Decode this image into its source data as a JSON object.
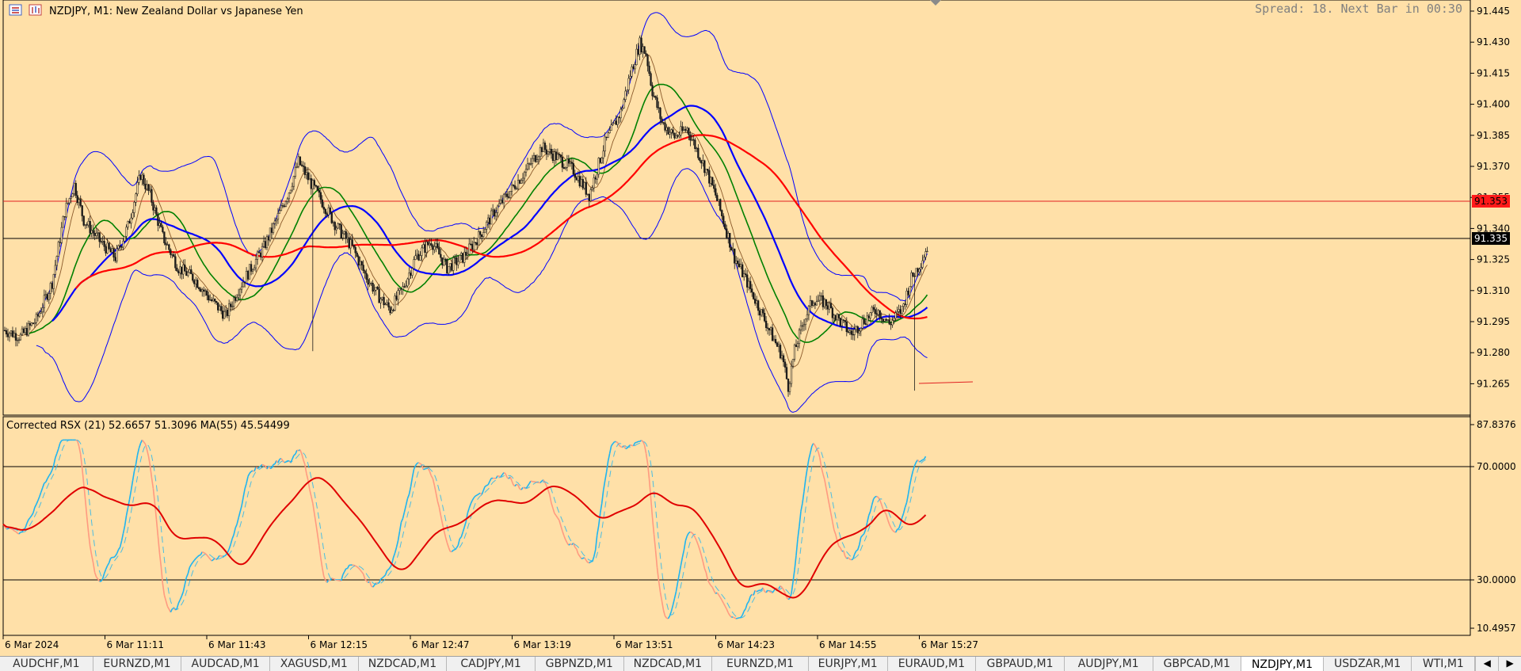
{
  "header": {
    "symbol_title": "NZDJPY, M1:  New Zealand Dollar vs Japanese Yen",
    "spread_text": "Spread: 18. Next Bar in 00:30",
    "menu_icon": "chart-menu-icon",
    "chart_icon": "chart-type-icon"
  },
  "colors": {
    "background": "#ffe0a8",
    "candles": "#1a1a1a",
    "bollinger": "#0000ff",
    "ma_red": "#ff0000",
    "ma_blue": "#0000ff",
    "ma_green": "#008000",
    "ma_thin": "#8b5a2b",
    "rsx_up": "#1eb4f0",
    "rsx_down": "#ff9a80",
    "rsx_ma": "#e00000"
  },
  "price_panel": {
    "ticks": [
      "91.445",
      "91.430",
      "91.415",
      "91.400",
      "91.385",
      "91.370",
      "91.355",
      "91.340",
      "91.325",
      "91.310",
      "91.295",
      "91.280",
      "91.265"
    ],
    "level_line_label": "91.353",
    "current_price_label": "91.335"
  },
  "indicator_panel": {
    "title": "Corrected RSX (21) 52.6657 51.3096 MA(55) 45.54499",
    "ticks": [
      "87.8376",
      "70.0000",
      "30.0000",
      "10.4957"
    ]
  },
  "time_axis": [
    "6 Mar 2024",
    "6 Mar 11:11",
    "6 Mar 11:43",
    "6 Mar 12:15",
    "6 Mar 12:47",
    "6 Mar 13:19",
    "6 Mar 13:51",
    "6 Mar 14:23",
    "6 Mar 14:55",
    "6 Mar 15:27"
  ],
  "tabs": [
    {
      "label": "AUDCHF,M1",
      "active": false
    },
    {
      "label": "EURNZD,M1",
      "active": false
    },
    {
      "label": "AUDCAD,M1",
      "active": false
    },
    {
      "label": "XAGUSD,M1",
      "active": false
    },
    {
      "label": "NZDCAD,M1",
      "active": false
    },
    {
      "label": "CADJPY,M1",
      "active": false
    },
    {
      "label": "GBPNZD,M1",
      "active": false
    },
    {
      "label": "NZDCAD,M1",
      "active": false
    },
    {
      "label": "EURNZD,M1",
      "active": false
    },
    {
      "label": "EURJPY,M1",
      "active": false
    },
    {
      "label": "EURAUD,M1",
      "active": false
    },
    {
      "label": "GBPAUD,M1",
      "active": false
    },
    {
      "label": "AUDJPY,M1",
      "active": false
    },
    {
      "label": "GBPCAD,M1",
      "active": false
    },
    {
      "label": "NZDJPY,M1",
      "active": true
    },
    {
      "label": "USDZAR,M1",
      "active": false
    },
    {
      "label": "WTI,M1",
      "active": false
    }
  ],
  "tab_scroll": {
    "left_arrow": "◀",
    "right_arrow": "▶"
  },
  "chart_data": {
    "type": "candlestick",
    "price_range": [
      91.255,
      91.45
    ],
    "rsx_range": [
      10.4957,
      87.8376
    ],
    "close_path": [
      [
        0,
        91.295
      ],
      [
        10,
        91.292
      ],
      [
        20,
        91.3
      ],
      [
        30,
        91.318
      ],
      [
        38,
        91.352
      ],
      [
        44,
        91.365
      ],
      [
        50,
        91.348
      ],
      [
        60,
        91.338
      ],
      [
        70,
        91.33
      ],
      [
        78,
        91.345
      ],
      [
        86,
        91.37
      ],
      [
        92,
        91.36
      ],
      [
        100,
        91.34
      ],
      [
        110,
        91.325
      ],
      [
        120,
        91.32
      ],
      [
        130,
        91.31
      ],
      [
        140,
        91.302
      ],
      [
        148,
        91.315
      ],
      [
        156,
        91.325
      ],
      [
        164,
        91.335
      ],
      [
        172,
        91.348
      ],
      [
        180,
        91.362
      ],
      [
        186,
        91.376
      ],
      [
        192,
        91.368
      ],
      [
        200,
        91.358
      ],
      [
        210,
        91.345
      ],
      [
        220,
        91.335
      ],
      [
        228,
        91.322
      ],
      [
        236,
        91.312
      ],
      [
        244,
        91.305
      ],
      [
        252,
        91.315
      ],
      [
        260,
        91.33
      ],
      [
        270,
        91.338
      ],
      [
        280,
        91.325
      ],
      [
        290,
        91.33
      ],
      [
        300,
        91.34
      ],
      [
        310,
        91.352
      ],
      [
        320,
        91.362
      ],
      [
        330,
        91.372
      ],
      [
        340,
        91.383
      ],
      [
        350,
        91.378
      ],
      [
        360,
        91.372
      ],
      [
        370,
        91.36
      ],
      [
        380,
        91.385
      ],
      [
        390,
        91.4
      ],
      [
        396,
        91.418
      ],
      [
        402,
        91.433
      ],
      [
        406,
        91.428
      ],
      [
        410,
        91.41
      ],
      [
        416,
        91.395
      ],
      [
        424,
        91.388
      ],
      [
        432,
        91.392
      ],
      [
        438,
        91.382
      ],
      [
        444,
        91.372
      ],
      [
        450,
        91.36
      ],
      [
        456,
        91.345
      ],
      [
        462,
        91.33
      ],
      [
        470,
        91.318
      ],
      [
        478,
        91.305
      ],
      [
        486,
        91.292
      ],
      [
        492,
        91.283
      ],
      [
        496,
        91.268
      ],
      [
        500,
        91.285
      ],
      [
        506,
        91.3
      ],
      [
        512,
        91.31
      ],
      [
        520,
        91.308
      ],
      [
        528,
        91.3
      ],
      [
        536,
        91.293
      ],
      [
        544,
        91.3
      ],
      [
        552,
        91.305
      ],
      [
        560,
        91.298
      ],
      [
        568,
        91.305
      ],
      [
        574,
        91.32
      ],
      [
        580,
        91.328
      ],
      [
        584,
        91.335
      ]
    ]
  }
}
